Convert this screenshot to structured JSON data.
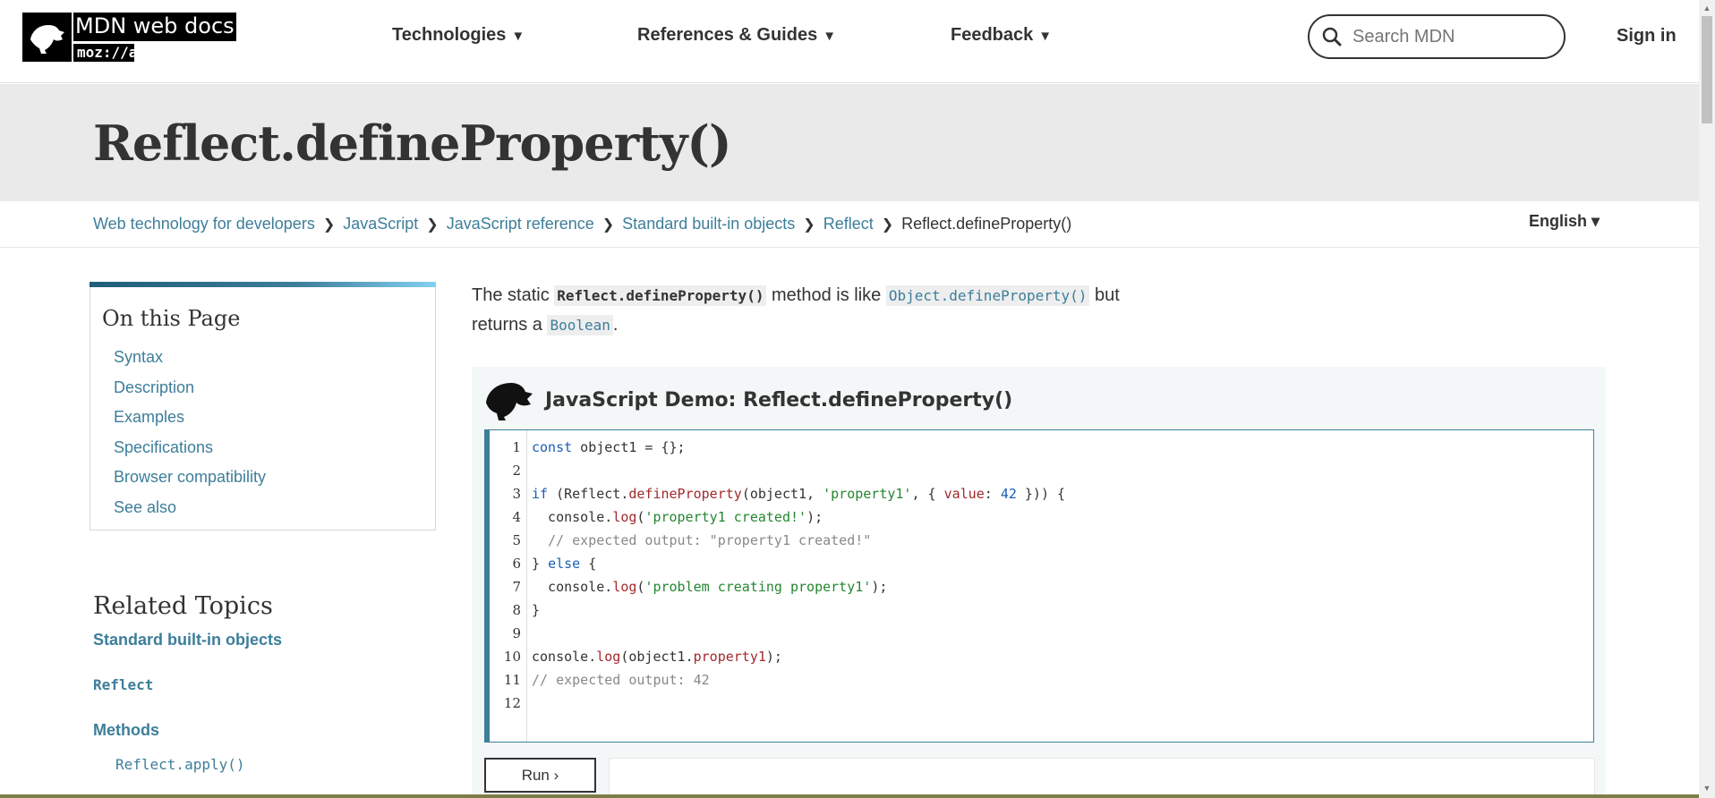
{
  "header": {
    "logo_title": "MDN web docs",
    "logo_sub": "moz://a",
    "nav": [
      {
        "label": "Technologies"
      },
      {
        "label": "References & Guides"
      },
      {
        "label": "Feedback"
      }
    ],
    "nav_arrow": "▼",
    "search_placeholder": "Search MDN",
    "signin": "Sign in"
  },
  "title": "Reflect.defineProperty()",
  "breadcrumb": [
    "Web technology for developers",
    "JavaScript",
    "JavaScript reference",
    "Standard built-in objects",
    "Reflect",
    "Reflect.defineProperty()"
  ],
  "language": "English ▾",
  "toc": {
    "title": "On this Page",
    "items": [
      "Syntax",
      "Description",
      "Examples",
      "Specifications",
      "Browser compatibility",
      "See also"
    ]
  },
  "related": {
    "title": "Related Topics",
    "group": "Standard built-in objects",
    "object": "Reflect",
    "methods_label": "Methods",
    "first_method": "Reflect.apply()"
  },
  "intro": {
    "t1": "The static ",
    "c1": "Reflect.defineProperty()",
    "t2": " method is like ",
    "c2": "Object.defineProperty()",
    "t3": " but",
    "t4": "returns a ",
    "c3": "Boolean",
    "t5": "."
  },
  "demo": {
    "title": "JavaScript Demo: Reflect.defineProperty()",
    "line_numbers": [
      "1",
      "2",
      "3",
      "4",
      "5",
      "6",
      "7",
      "8",
      "9",
      "10",
      "11",
      "12"
    ],
    "run_label": "Run ›"
  },
  "colors": {
    "link": "#3d7e9a",
    "text": "#333333",
    "title_band": "#eaeaea"
  }
}
